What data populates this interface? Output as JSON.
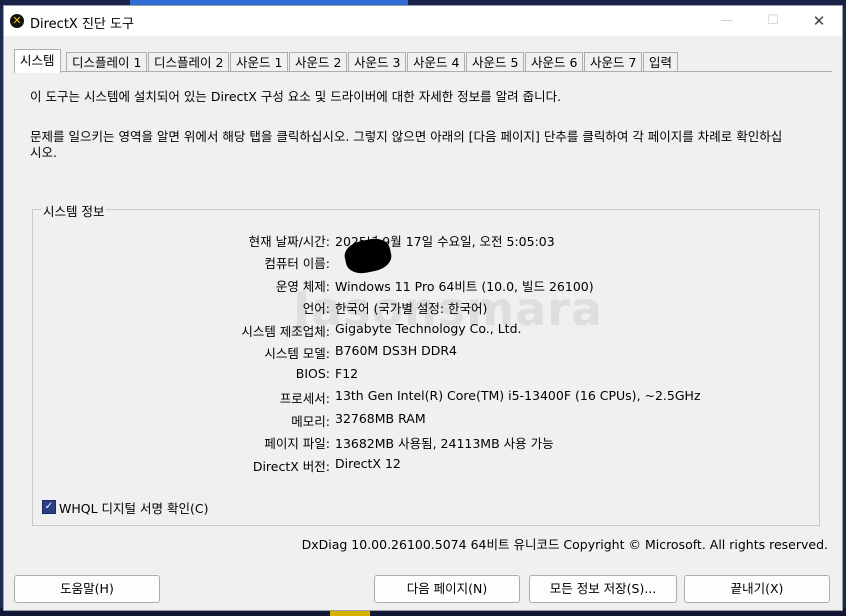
{
  "window": {
    "title": "DirectX 진단 도구",
    "close_glyph": "✕"
  },
  "tabs": [
    {
      "label": "시스템"
    },
    {
      "label": "디스플레이 1"
    },
    {
      "label": "디스플레이 2"
    },
    {
      "label": "사운드 1"
    },
    {
      "label": "사운드 2"
    },
    {
      "label": "사운드 3"
    },
    {
      "label": "사운드 4"
    },
    {
      "label": "사운드 5"
    },
    {
      "label": "사운드 6"
    },
    {
      "label": "사운드 7"
    },
    {
      "label": "입력"
    }
  ],
  "intro": {
    "line1": "이 도구는 시스템에 설치되어 있는 DirectX 구성 요소 및 드라이버에 대한 자세한 정보를 알려 줍니다.",
    "line2": "문제를 일으키는 영역을 알면 위에서 해당 탭을 클릭하십시오. 그렇지 않으면 아래의 [다음 페이지] 단추를 클릭하여 각 페이지를 차례로 확인하십시오."
  },
  "system_info": {
    "group_label": "시스템 정보",
    "rows": [
      {
        "label": "현재 날짜/시간:",
        "value": "2025년 9월 17일 수요일, 오전 5:05:03"
      },
      {
        "label": "컴퓨터 이름:",
        "value": ""
      },
      {
        "label": "운영 체제:",
        "value": "Windows 11 Pro 64비트 (10.0, 빌드 26100)"
      },
      {
        "label": "언어:",
        "value": "한국어 (국가별 설정: 한국어)"
      },
      {
        "label": "시스템 제조업체:",
        "value": "Gigabyte Technology Co., Ltd."
      },
      {
        "label": "시스템 모델:",
        "value": "B760M DS3H DDR4"
      },
      {
        "label": "BIOS:",
        "value": "F12"
      },
      {
        "label": "프로세서:",
        "value": "13th Gen Intel(R) Core(TM) i5-13400F (16 CPUs), ~2.5GHz"
      },
      {
        "label": "메모리:",
        "value": "32768MB RAM"
      },
      {
        "label": "페이지 파일:",
        "value": "13682MB 사용됨, 24113MB 사용 가능"
      },
      {
        "label": "DirectX 버전:",
        "value": "DirectX 12"
      }
    ],
    "watermark": "Jasonsmara"
  },
  "whql": {
    "label": "WHQL 디지털 서명 확인(C)",
    "checked": true,
    "check_glyph": "✓"
  },
  "footer": {
    "info": "DxDiag 10.00.26100.5074 64비트 유니코드  Copyright © Microsoft. All rights reserved."
  },
  "buttons": {
    "help": "도움말(H)",
    "next_page": "다음 페이지(N)",
    "save_all": "모든 정보 저장(S)...",
    "exit": "끝내기(X)"
  },
  "colors": {
    "accent": "#2b3f86",
    "window_bg": "#f0f0f0"
  }
}
